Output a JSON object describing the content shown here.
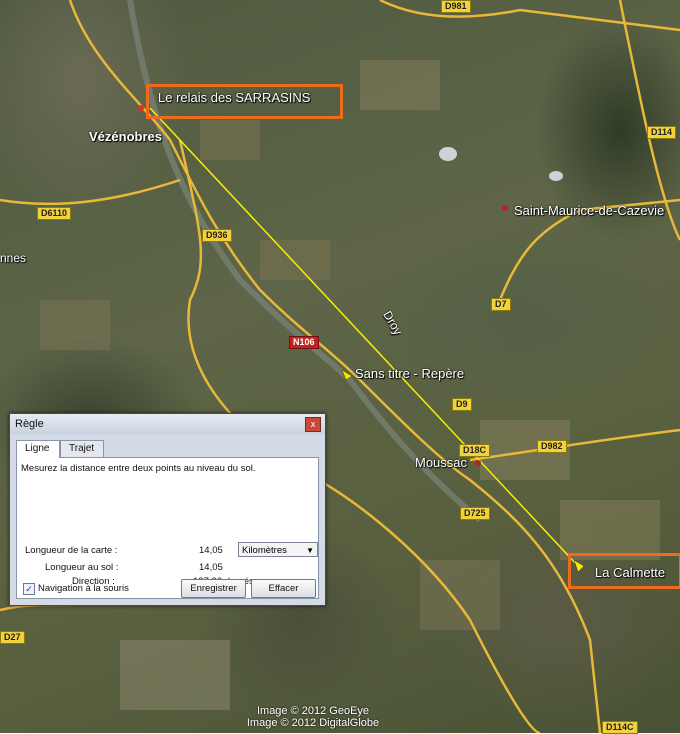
{
  "map": {
    "places": [
      {
        "name": "Vézénobres",
        "key": "vezenobres"
      },
      {
        "name": "Saint-Maurice-de-Cazevie",
        "key": "st-maurice"
      },
      {
        "name": "Moussac",
        "key": "moussac"
      },
      {
        "name": "Sans titre - Repère",
        "key": "sans-titre"
      },
      {
        "name": "Droy",
        "key": "droy"
      },
      {
        "name": "nnes",
        "key": "nnes"
      }
    ],
    "highlighted": {
      "start": "Le relais des SARRASINS",
      "end": "La Calmette"
    },
    "roads": [
      "D981",
      "D114",
      "D6110",
      "D936",
      "D7",
      "N106",
      "D18C",
      "D982",
      "D725",
      "D27",
      "D114C",
      "D9"
    ],
    "copyright": [
      "Image © 2012 GeoEye",
      "Image © 2012 DigitalGlobe"
    ]
  },
  "dialog": {
    "title": "Règle",
    "close": "x",
    "tabs": [
      "Ligne",
      "Trajet"
    ],
    "description": "Mesurez la distance entre deux points au niveau du sol.",
    "map_length_label": "Longueur de la carte :",
    "map_length_value": "14,05",
    "unit": "Kilomètres",
    "ground_length_label": "Longueur au sol :",
    "ground_length_value": "14,05",
    "direction_label": "Direction :",
    "direction_value": "137,36 degrés",
    "mouse_nav_label": "Navigation à la souris",
    "mouse_nav_checked": true,
    "save_label": "Enregistrer",
    "clear_label": "Effacer"
  },
  "colors": {
    "highlight_box": "#ee6a1c",
    "measure_line": "#f5f000",
    "road_badge": "#f2d23a"
  }
}
